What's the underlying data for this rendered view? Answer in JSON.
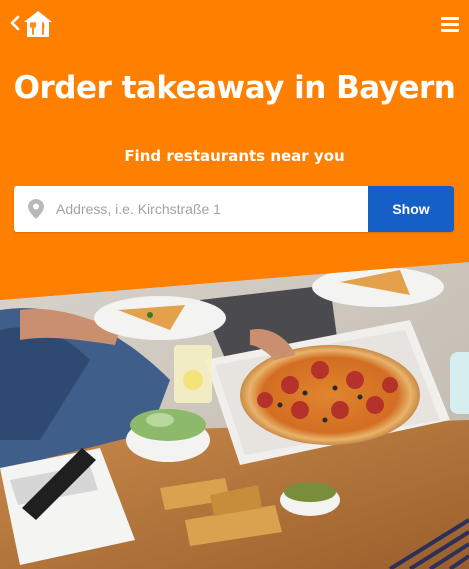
{
  "header": {
    "back_icon": "chevron-left-icon",
    "logo_icon": "house-with-fork-knife-logo",
    "menu_icon": "hamburger-menu-icon"
  },
  "hero": {
    "title": "Order takeaway in Bayern",
    "subtitle": "Find restaurants near you"
  },
  "search": {
    "placeholder": "Address, i.e. Kirchstraße 1",
    "value": "",
    "button_label": "Show",
    "icon": "location-pin-icon"
  },
  "colors": {
    "brand_orange": "#ff8000",
    "button_blue": "#1560c7",
    "white": "#ffffff"
  }
}
